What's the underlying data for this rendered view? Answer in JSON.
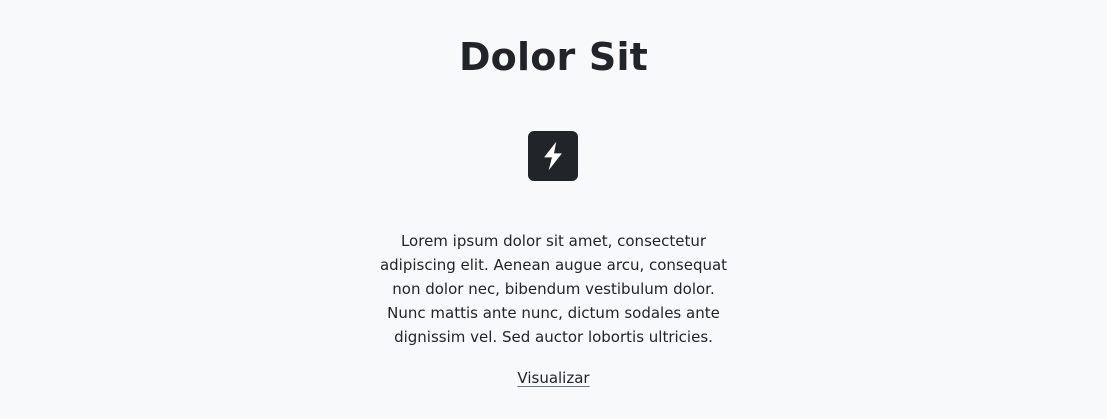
{
  "section": {
    "title": "Dolor Sit",
    "icon": "lightning-bolt-icon",
    "description": "Lorem ipsum dolor sit amet, consectetur adipiscing elit. Aenean augue arcu, consequat non dolor nec, bibendum vestibulum dolor. Nunc mattis ante nunc, dictum sodales ante dignissim vel. Sed auctor lobortis ultricies.",
    "link_label": "Visualizar"
  },
  "colors": {
    "background": "#f8f9fa",
    "text": "#212529",
    "icon_background": "#212529",
    "icon_foreground": "#ffffff"
  }
}
